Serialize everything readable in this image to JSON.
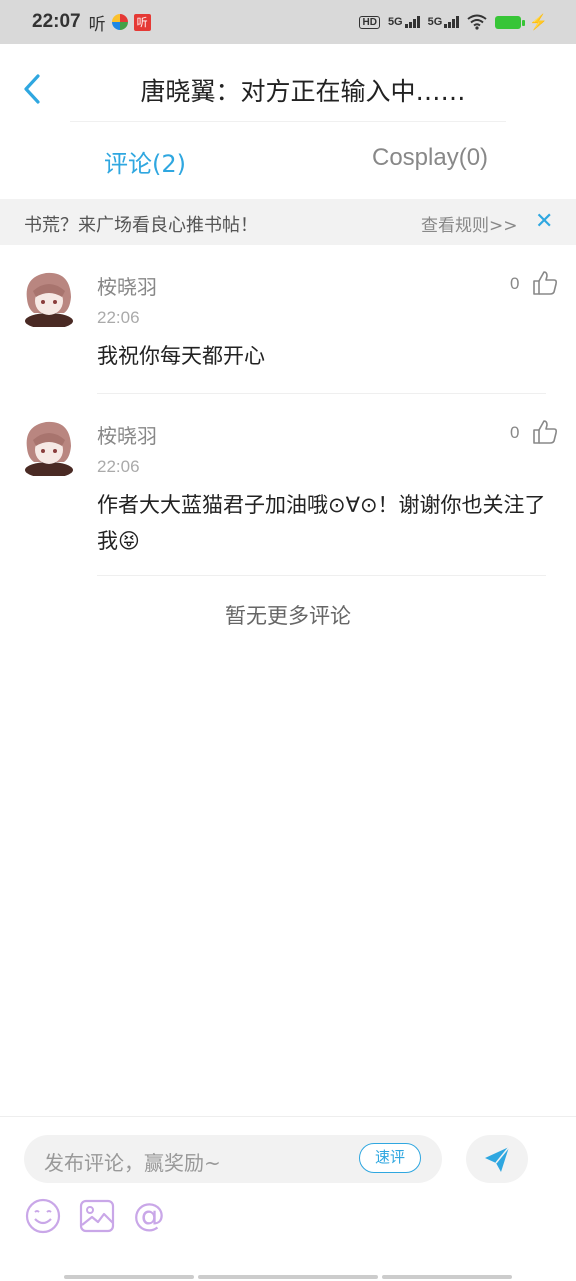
{
  "status_bar": {
    "time": "22:07",
    "left_icons": [
      "听",
      "听"
    ],
    "network": "5G",
    "hd": "HD"
  },
  "header": {
    "title": "唐晓翼：对方正在输入中……"
  },
  "tabs": [
    {
      "label": "评论(2)",
      "active": true
    },
    {
      "label": "Cosplay(0)",
      "active": false
    }
  ],
  "notice": {
    "text": "书荒？来广场看良心推书帖！",
    "link": "查看规则>>",
    "close": "✕"
  },
  "comments": [
    {
      "user": "桉晓羽",
      "time": "22:06",
      "text": "我祝你每天都开心",
      "likes": "0"
    },
    {
      "user": "桉晓羽",
      "time": "22:06",
      "text": "作者大大蓝猫君子加油哦⊙∀⊙！谢谢你也关注了我😝",
      "likes": "0"
    }
  ],
  "footer_text": "暂无更多评论",
  "composer": {
    "placeholder": "发布评论，赢奖励~",
    "quick_label": "速评"
  },
  "colors": {
    "accent": "#2fa7e0",
    "tool_icon": "#c9a7e8"
  },
  "icons": [
    "back-arrow-icon",
    "thumb-up-icon",
    "send-icon",
    "emoji-icon",
    "image-icon",
    "at-icon",
    "close-icon"
  ]
}
